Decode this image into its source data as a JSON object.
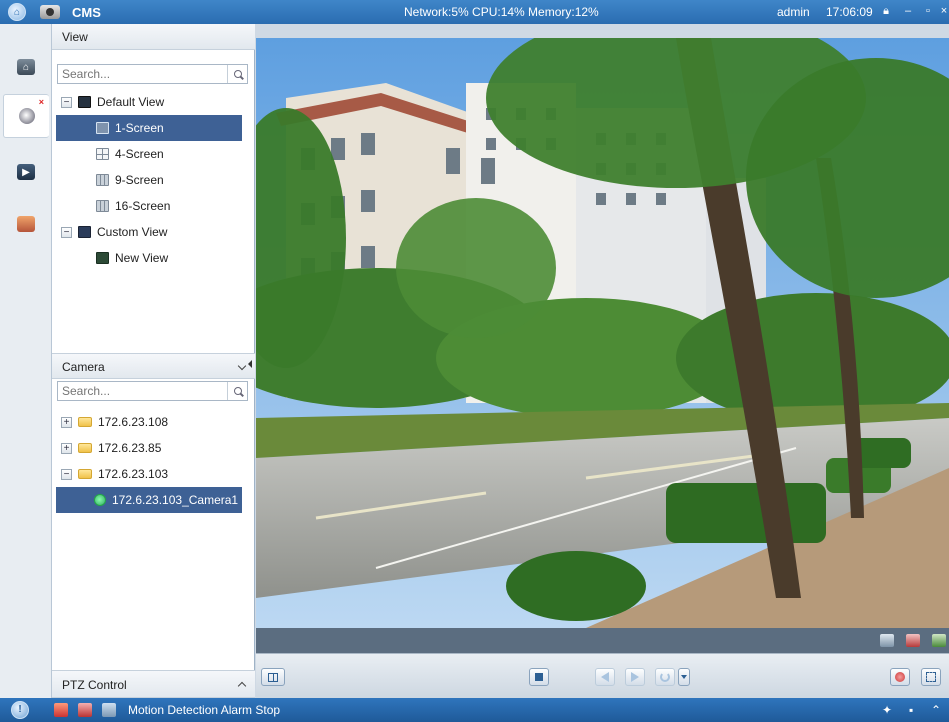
{
  "titlebar": {
    "app_name": "CMS",
    "system_info": "Network:5% CPU:14% Memory:12%",
    "user": "admin",
    "clock": "17:06:09"
  },
  "view_panel": {
    "header": "View",
    "search_placeholder": "Search...",
    "items": [
      {
        "label": "Default View"
      },
      {
        "label": "1-Screen"
      },
      {
        "label": "4-Screen"
      },
      {
        "label": "9-Screen"
      },
      {
        "label": "16-Screen"
      },
      {
        "label": "Custom View"
      },
      {
        "label": "New View"
      }
    ]
  },
  "camera_panel": {
    "header": "Camera",
    "search_placeholder": "Search...",
    "items": [
      {
        "label": "172.6.23.108"
      },
      {
        "label": "172.6.23.85"
      },
      {
        "label": "172.6.23.103"
      },
      {
        "label": "172.6.23.103_Camera1"
      }
    ]
  },
  "ptz_panel": {
    "header": "PTZ Control"
  },
  "statusbar": {
    "message": "Motion Detection Alarm Stop"
  },
  "colors": {
    "titlebar": "#2f75bd",
    "selection": "#3e6195",
    "video_bar": "#5b6d80"
  }
}
